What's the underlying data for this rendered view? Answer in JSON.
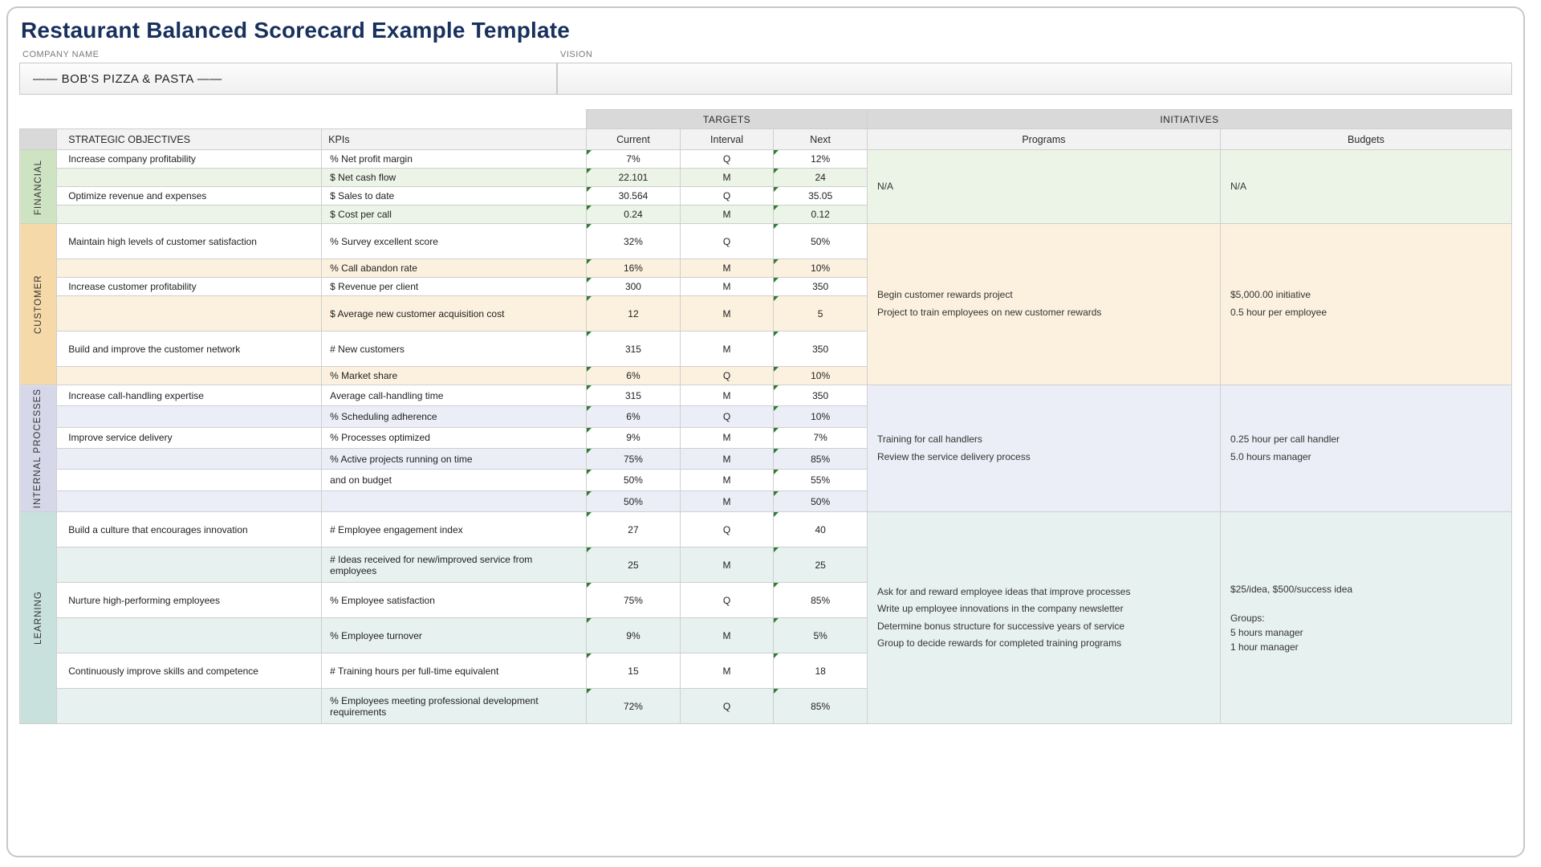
{
  "title": "Restaurant Balanced Scorecard Example Template",
  "meta": {
    "company_label": "COMPANY NAME",
    "vision_label": "VISION",
    "company_value": "—— BOB'S PIZZA & PASTA ——",
    "vision_value": ""
  },
  "headers": {
    "targets": "TARGETS",
    "initiatives": "INITIATIVES",
    "objectives": "STRATEGIC OBJECTIVES",
    "kpis": "KPIs",
    "current": "Current",
    "interval": "Interval",
    "next": "Next",
    "programs": "Programs",
    "budgets": "Budgets"
  },
  "sections": {
    "financial": {
      "label": "FINANCIAL",
      "programs": "N/A",
      "budgets": "N/A",
      "rows": [
        {
          "obj": "Increase company profitability",
          "kpi": "% Net profit margin",
          "cur": "7%",
          "int": "Q",
          "next": "12%"
        },
        {
          "obj": "",
          "kpi": "$ Net cash flow",
          "cur": "22.101",
          "int": "M",
          "next": "24"
        },
        {
          "obj": "Optimize revenue and expenses",
          "kpi": "$ Sales to date",
          "cur": "30.564",
          "int": "Q",
          "next": "35.05"
        },
        {
          "obj": "",
          "kpi": "$ Cost per call",
          "cur": "0.24",
          "int": "M",
          "next": "0.12"
        }
      ]
    },
    "customer": {
      "label": "CUSTOMER",
      "programs": "Begin customer rewards project\nProject to train employees on new customer rewards",
      "budgets": "$5,000.00 initiative\n0.5 hour per employee",
      "rows": [
        {
          "obj": "Maintain high levels of customer satisfaction",
          "kpi": "% Survey excellent score",
          "cur": "32%",
          "int": "Q",
          "next": "50%"
        },
        {
          "obj": "",
          "kpi": "% Call abandon rate",
          "cur": "16%",
          "int": "M",
          "next": "10%"
        },
        {
          "obj": "Increase customer profitability",
          "kpi": "$ Revenue per client",
          "cur": "300",
          "int": "M",
          "next": "350"
        },
        {
          "obj": "",
          "kpi": "$ Average new customer acquisition cost",
          "cur": "12",
          "int": "M",
          "next": "5"
        },
        {
          "obj": "Build and improve the customer network",
          "kpi": "# New customers",
          "cur": "315",
          "int": "M",
          "next": "350"
        },
        {
          "obj": "",
          "kpi": "% Market share",
          "cur": "6%",
          "int": "Q",
          "next": "10%"
        }
      ]
    },
    "internal": {
      "label": "INTERNAL PROCESSES",
      "programs": "Training for call handlers\nReview the service delivery process",
      "budgets": "0.25 hour per call handler\n5.0 hours manager",
      "rows": [
        {
          "obj": "Increase call-handling expertise",
          "kpi": "Average call-handling time",
          "cur": "315",
          "int": "M",
          "next": "350"
        },
        {
          "obj": "",
          "kpi": "% Scheduling adherence",
          "cur": "6%",
          "int": "Q",
          "next": "10%"
        },
        {
          "obj": "Improve service delivery",
          "kpi": "% Processes optimized",
          "cur": "9%",
          "int": "M",
          "next": "7%"
        },
        {
          "obj": "",
          "kpi": "% Active projects running on time",
          "cur": "75%",
          "int": "M",
          "next": "85%"
        },
        {
          "obj": "",
          "kpi": "and on budget",
          "cur": "50%",
          "int": "M",
          "next": "55%"
        },
        {
          "obj": "",
          "kpi": "",
          "cur": "50%",
          "int": "M",
          "next": "50%"
        }
      ]
    },
    "learning": {
      "label": "LEARNING",
      "programs": "Ask for and reward employee ideas that improve processes\nWrite up employee innovations in the company newsletter\nDetermine bonus structure for successive years of service\nGroup to decide rewards for completed training programs",
      "budgets": "$25/idea, $500/success idea\n\nGroups:\n5 hours manager\n1 hour manager",
      "rows": [
        {
          "obj": "Build a culture that encourages innovation",
          "kpi": "# Employee engagement index",
          "cur": "27",
          "int": "Q",
          "next": "40"
        },
        {
          "obj": "",
          "kpi": "# Ideas received for new/improved service from employees",
          "cur": "25",
          "int": "M",
          "next": "25"
        },
        {
          "obj": "Nurture high-performing employees",
          "kpi": "% Employee satisfaction",
          "cur": "75%",
          "int": "Q",
          "next": "85%"
        },
        {
          "obj": "",
          "kpi": "% Employee turnover",
          "cur": "9%",
          "int": "M",
          "next": "5%"
        },
        {
          "obj": "Continuously improve skills and competence",
          "kpi": "# Training hours per full-time equivalent",
          "cur": "15",
          "int": "M",
          "next": "18"
        },
        {
          "obj": "",
          "kpi": "% Employees meeting professional development requirements",
          "cur": "72%",
          "int": "Q",
          "next": "85%"
        }
      ]
    }
  }
}
